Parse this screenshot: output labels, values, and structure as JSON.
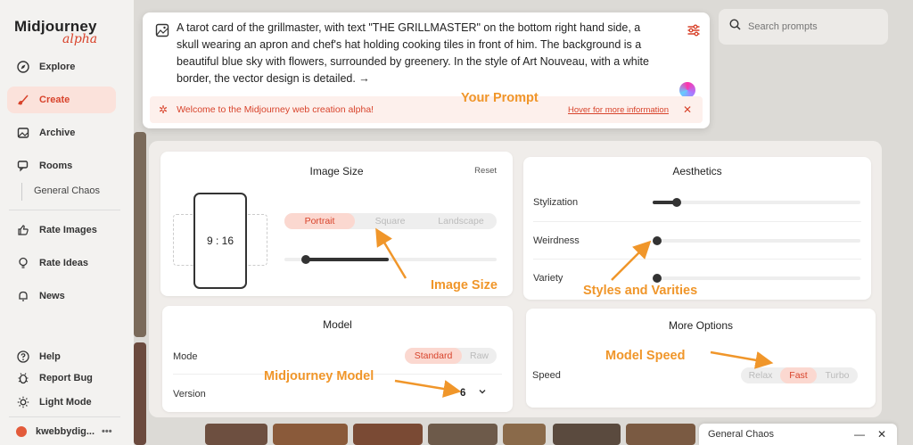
{
  "sidebar": {
    "logo_main": "Midjourney",
    "logo_sub": "alpha",
    "items": [
      {
        "label": "Explore",
        "icon": "compass-icon"
      },
      {
        "label": "Create",
        "icon": "brush-icon"
      },
      {
        "label": "Archive",
        "icon": "image-icon"
      },
      {
        "label": "Rooms",
        "icon": "chat-icon"
      },
      {
        "label": "Rate Images",
        "icon": "thumbs-up-icon"
      },
      {
        "label": "Rate Ideas",
        "icon": "bulb-icon"
      },
      {
        "label": "News",
        "icon": "bell-icon"
      },
      {
        "label": "Help",
        "icon": "help-icon"
      },
      {
        "label": "Report Bug",
        "icon": "bug-icon"
      },
      {
        "label": "Light Mode",
        "icon": "sun-icon"
      }
    ],
    "room_sub": "General Chaos",
    "user": "kwebbydig...",
    "user_more": "•••"
  },
  "prompt": {
    "text": "A tarot card of the grillmaster, with text \"THE GRILLMASTER\" on the bottom right hand side, a skull wearing an apron and chef's hat holding cooking tiles in front of him. The background is a beautiful blue sky with flowers, surrounded by greenery. In the style of Art Nouveau, with a white border, the vector design is detailed. →",
    "welcome": "Welcome to the Midjourney web creation alpha!",
    "hover_link": "Hover for more information",
    "close": "✕"
  },
  "search": {
    "placeholder": "Search prompts"
  },
  "image_size": {
    "title": "Image Size",
    "reset": "Reset",
    "ratio": "9 : 16",
    "options": [
      "Portrait",
      "Square",
      "Landscape"
    ],
    "selected": "Portrait",
    "slider_value": 0.5
  },
  "aesthetics": {
    "title": "Aesthetics",
    "rows": [
      {
        "label": "Stylization",
        "value": 0.12
      },
      {
        "label": "Weirdness",
        "value": 0.0
      },
      {
        "label": "Variety",
        "value": 0.0
      }
    ]
  },
  "model": {
    "title": "Model",
    "mode_label": "Mode",
    "mode_options": [
      "Standard",
      "Raw"
    ],
    "mode_selected": "Standard",
    "version_label": "Version",
    "version_value": "6",
    "chevron": "⌄"
  },
  "more_options": {
    "title": "More Options",
    "speed_label": "Speed",
    "speed_options": [
      "Relax",
      "Fast",
      "Turbo"
    ],
    "speed_selected": "Fast"
  },
  "annotations": {
    "prompt": "Your Prompt",
    "image_size": "Image Size",
    "styles": "Styles and Varities",
    "model": "Midjourney Model",
    "speed": "Model Speed"
  },
  "chat": {
    "title": "General Chaos",
    "minimize": "—",
    "close": "✕"
  },
  "colors": {
    "accent": "#d8432b",
    "annotation": "#f0962a",
    "selected_bg": "#fbd8d0"
  }
}
